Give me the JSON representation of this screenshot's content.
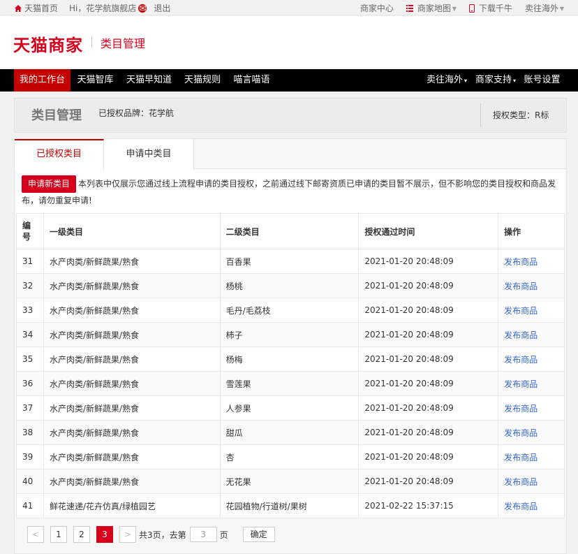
{
  "topbar": {
    "home": "天猫首页",
    "greeting": "Hi，花学航旗舰店",
    "logout": "退出",
    "merchant_center": "商家中心",
    "sitemap": "商家地图",
    "download": "下载千牛",
    "overseas": "卖往海外"
  },
  "header": {
    "logo": "天猫商家",
    "subtitle": "类目管理"
  },
  "nav": {
    "items": [
      "我的工作台",
      "天猫智库",
      "天猫早知道",
      "天猫规则",
      "喵言喵语"
    ],
    "right": [
      "卖往海外",
      "商家支持",
      "账号设置"
    ]
  },
  "panel": {
    "title": "类目管理",
    "brand": "已授权品牌：花学航",
    "auth_type": "授权类型：R标"
  },
  "tabs": [
    "已授权类目",
    "申请中类目"
  ],
  "notice": {
    "button": "申请新类目",
    "text": "本列表中仅展示您通过线上流程申请的类目授权，之前通过线下邮寄资质已申请的类目暂不展示，但不影响您的类目授权和商品发布，请勿重复申请!"
  },
  "table": {
    "headers": [
      "编号",
      "一级类目",
      "二级类目",
      "授权通过时间",
      "操作"
    ],
    "rows": [
      [
        "31",
        "水产肉类/新鲜蔬果/熟食",
        "百香果",
        "2021-01-20 20:48:09",
        "发布商品"
      ],
      [
        "32",
        "水产肉类/新鲜蔬果/熟食",
        "杨桃",
        "2021-01-20 20:48:09",
        "发布商品"
      ],
      [
        "33",
        "水产肉类/新鲜蔬果/熟食",
        "毛丹/毛荔枝",
        "2021-01-20 20:48:09",
        "发布商品"
      ],
      [
        "34",
        "水产肉类/新鲜蔬果/熟食",
        "柿子",
        "2021-01-20 20:48:09",
        "发布商品"
      ],
      [
        "35",
        "水产肉类/新鲜蔬果/熟食",
        "杨梅",
        "2021-01-20 20:48:09",
        "发布商品"
      ],
      [
        "36",
        "水产肉类/新鲜蔬果/熟食",
        "雪莲果",
        "2021-01-20 20:48:09",
        "发布商品"
      ],
      [
        "37",
        "水产肉类/新鲜蔬果/熟食",
        "人参果",
        "2021-01-20 20:48:09",
        "发布商品"
      ],
      [
        "38",
        "水产肉类/新鲜蔬果/熟食",
        "甜瓜",
        "2021-01-20 20:48:09",
        "发布商品"
      ],
      [
        "39",
        "水产肉类/新鲜蔬果/熟食",
        "杏",
        "2021-01-20 20:48:09",
        "发布商品"
      ],
      [
        "40",
        "水产肉类/新鲜蔬果/熟食",
        "无花果",
        "2021-01-20 20:48:09",
        "发布商品"
      ],
      [
        "41",
        "鲜花速递/花卉仿真/绿植园艺",
        "花园植物/行道树/果树",
        "2021-02-22 15:37:15",
        "发布商品"
      ]
    ]
  },
  "pager": {
    "prev": "<",
    "pages": [
      "1",
      "2",
      "3"
    ],
    "current": "3",
    "next": ">",
    "total": "共3页，去第",
    "input_placeholder": "3",
    "unit": "页",
    "confirm": "确定"
  },
  "colors": {
    "brand_red": "#d6001c",
    "link_blue": "#3366cc",
    "nav_black": "#000000"
  }
}
